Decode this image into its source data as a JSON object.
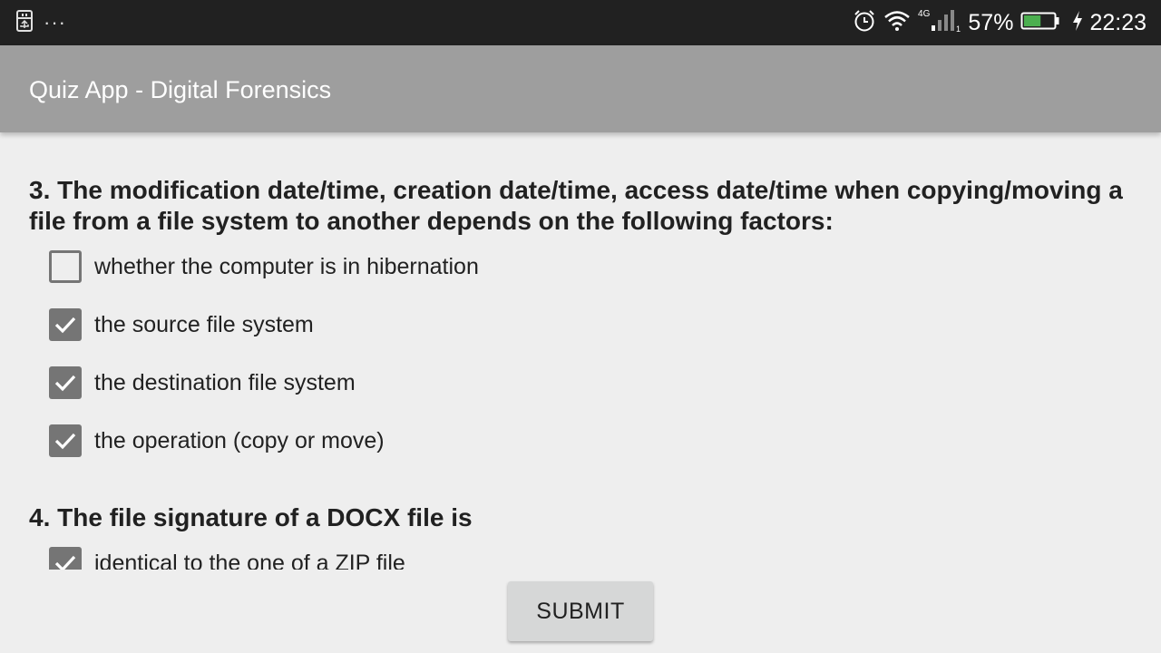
{
  "status_bar": {
    "usb_icon": "usb-debug-icon",
    "more_dots": "···",
    "network_label": "4G",
    "battery_percent": "57%",
    "battery_level": 0.57,
    "time": "22:23",
    "icons": [
      "alarm-clock-icon",
      "wifi-icon",
      "signal-icon",
      "battery-icon",
      "charging-bolt-icon"
    ]
  },
  "app_bar": {
    "title": "Quiz App - Digital Forensics"
  },
  "questions": [
    {
      "text": "3. The modification date/time, creation date/time, access date/time when copying/moving a file from a file system to another depends on the following factors:",
      "options": [
        {
          "label": "whether the computer is in hibernation",
          "checked": false
        },
        {
          "label": "the source file system",
          "checked": true
        },
        {
          "label": "the destination file system",
          "checked": true
        },
        {
          "label": "the operation (copy or move)",
          "checked": true
        }
      ]
    },
    {
      "text": "4. The file signature of a DOCX file is",
      "options": [
        {
          "label": "identical to the one of a ZIP file",
          "checked": true
        }
      ]
    }
  ],
  "submit_label": "SUBMIT",
  "colors": {
    "status_bar": "#212121",
    "app_bar": "#9e9e9e",
    "background": "#eeeeee",
    "checkbox": "#757575",
    "battery_fill": "#4caf50"
  }
}
